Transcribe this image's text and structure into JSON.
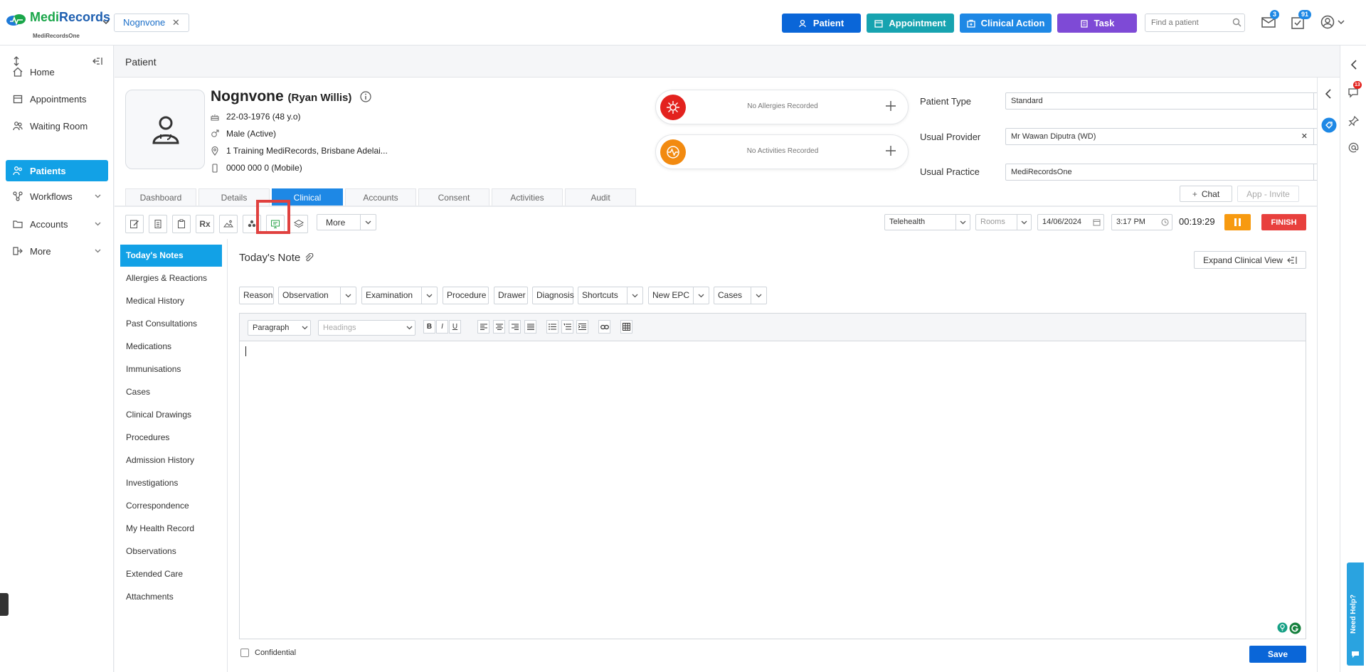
{
  "app": {
    "logo_name_a": "Medi",
    "logo_name_b": "Records",
    "logo_sub": "MediRecordsOne",
    "patient_chip": "Nognvone",
    "top_buttons": {
      "patient": "Patient",
      "appointment": "Appointment",
      "clinical_action": "Clinical Action",
      "task": "Task"
    },
    "search_placeholder": "Find a patient",
    "mail_badge": "3",
    "tasks_badge": "91",
    "colors": {
      "patient_btn": "#0a66d8",
      "appointment_btn": "#17a3b0",
      "clinical_btn": "#1e88e5",
      "task_btn": "#7e4ad6",
      "accent": "#12a1e6",
      "finish": "#e8403d",
      "pause": "#f79a10"
    }
  },
  "leftnav": {
    "items": [
      {
        "label": "Home",
        "icon": "home-icon"
      },
      {
        "label": "Appointments",
        "icon": "calendar-icon"
      },
      {
        "label": "Waiting Room",
        "icon": "people-icon"
      },
      {
        "label": "Patients",
        "icon": "patients-icon",
        "active": true
      },
      {
        "label": "Workflows",
        "icon": "workflow-icon",
        "expandable": true
      },
      {
        "label": "Accounts",
        "icon": "folder-icon",
        "expandable": true
      },
      {
        "label": "More",
        "icon": "more-icon",
        "expandable": true
      }
    ]
  },
  "page": {
    "title": "Patient"
  },
  "patient": {
    "name": "Nognvone",
    "alias": "(Ryan Willis)",
    "dob": "22-03-1976 (48 y.o)",
    "gender": "Male (Active)",
    "address": "1 Training MediRecords, Brisbane Adelai...",
    "phone": "0000 000 0 (Mobile)"
  },
  "alerts": {
    "allergies": "No Allergies Recorded",
    "activities": "No Activities Recorded"
  },
  "fields": {
    "patient_type_label": "Patient Type",
    "patient_type_value": "Standard",
    "usual_provider_label": "Usual Provider",
    "usual_provider_value": "Mr Wawan Diputra (WD)",
    "usual_practice_label": "Usual Practice",
    "usual_practice_value": "MediRecordsOne"
  },
  "actions": {
    "chat": "Chat",
    "app_invite": "App - Invite"
  },
  "tabs": [
    "Dashboard",
    "Details",
    "Clinical",
    "Accounts",
    "Consent",
    "Activities",
    "Audit"
  ],
  "active_tab": "Clinical",
  "toolbar": {
    "more": "More",
    "rx": "Rx",
    "visit_type": "Telehealth",
    "rooms_placeholder": "Rooms",
    "date": "14/06/2024",
    "time": "3:17 PM",
    "timer": "00:19:29",
    "finish": "FINISH"
  },
  "subnav": [
    "Today's Notes",
    "Allergies & Reactions",
    "Medical History",
    "Past Consultations",
    "Medications",
    "Immunisations",
    "Cases",
    "Clinical Drawings",
    "Procedures",
    "Admission History",
    "Investigations",
    "Correspondence",
    "My Health Record",
    "Observations",
    "Extended Care",
    "Attachments"
  ],
  "note": {
    "title": "Today's Note",
    "expand": "Expand Clinical View",
    "chips": {
      "reason": "Reason",
      "observation": "Observation",
      "examination": "Examination",
      "procedure": "Procedure",
      "drawer": "Drawer",
      "diagnosis": "Diagnosis",
      "shortcuts": "Shortcuts",
      "new_epc": "New EPC",
      "cases": "Cases"
    },
    "editor": {
      "paragraph": "Paragraph",
      "headings": "Headings",
      "bold": "B",
      "italic": "I",
      "underline": "U"
    },
    "confidential": "Confidential",
    "save": "Save"
  },
  "rightrail": {
    "chat_badge": "13",
    "need_help": "Need Help?"
  }
}
